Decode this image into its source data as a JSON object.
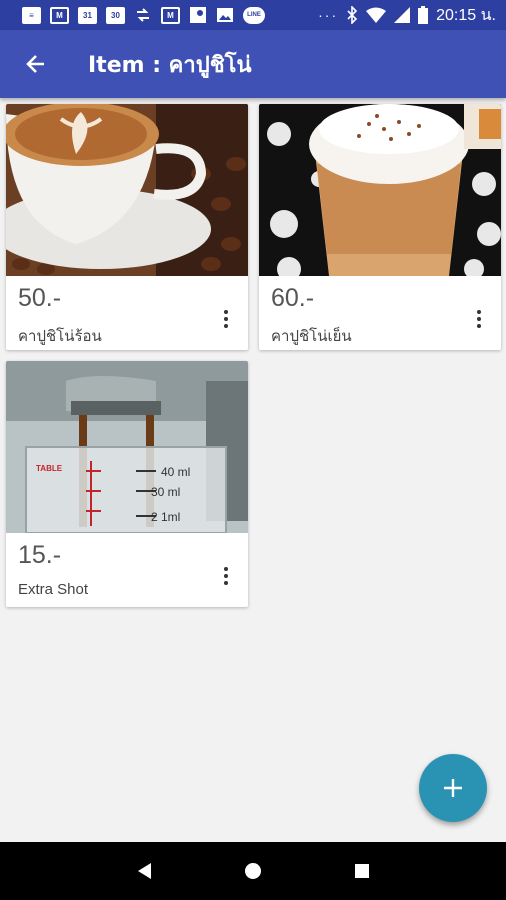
{
  "status_bar": {
    "icons": [
      "message-icon",
      "gmail-icon",
      "calendar-31-icon",
      "calendar-30-icon",
      "sync-icon",
      "gmail-icon",
      "maps-icon",
      "image-icon",
      "line-icon"
    ],
    "calendar_a": "31",
    "calendar_b": "30",
    "line_label": "LINE",
    "overflow": "···",
    "time": "20:15 น."
  },
  "app_bar": {
    "title": "Item : คาปูชิโน่",
    "color": "#3f51b5"
  },
  "items": [
    {
      "price": "50.-",
      "name": "คาปูชิโน่ร้อน",
      "image": "hot-cappuccino-photo"
    },
    {
      "price": "60.-",
      "name": "คาปูชิโน่เย็น",
      "image": "iced-cappuccino-photo"
    },
    {
      "price": "15.-",
      "name": "Extra Shot",
      "image": "espresso-shot-photo"
    }
  ],
  "fab": {
    "icon": "plus-icon",
    "color": "#2a93b4"
  },
  "nav_bar": {
    "icons": [
      "back-triangle-icon",
      "home-circle-icon",
      "recents-square-icon"
    ]
  }
}
